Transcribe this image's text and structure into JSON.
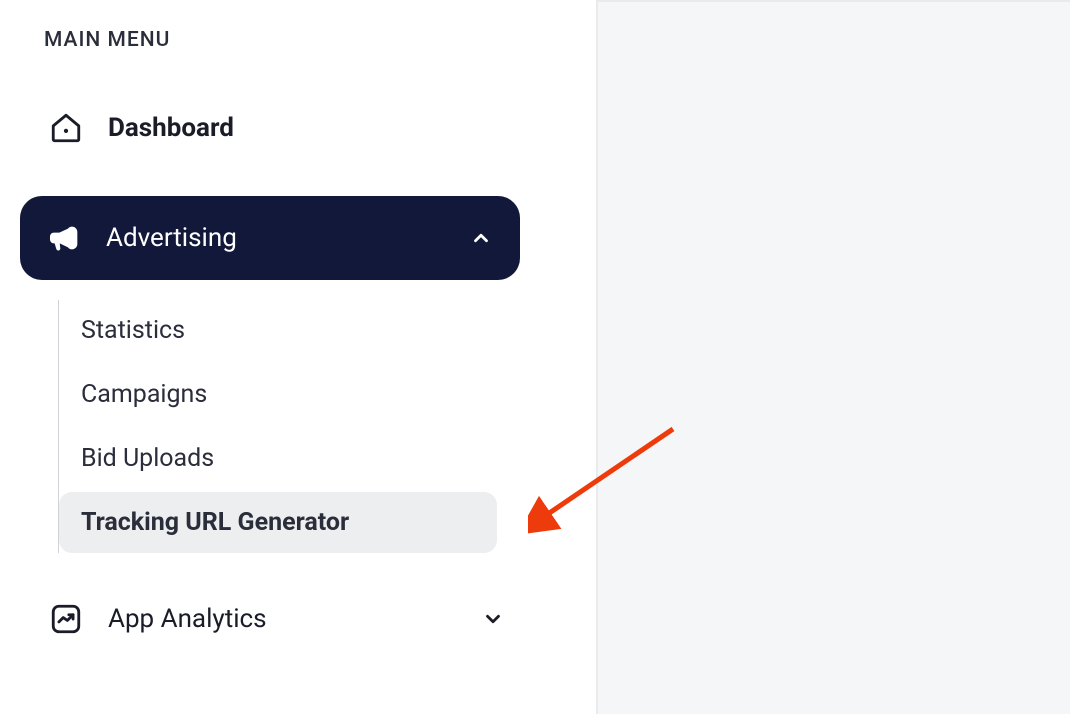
{
  "sidebar": {
    "section_label": "MAIN MENU",
    "items": [
      {
        "label": "Dashboard"
      },
      {
        "label": "Advertising"
      },
      {
        "label": "App Analytics"
      }
    ],
    "advertising_submenu": [
      {
        "label": "Statistics"
      },
      {
        "label": "Campaigns"
      },
      {
        "label": "Bid Uploads"
      },
      {
        "label": "Tracking URL Generator"
      }
    ]
  }
}
